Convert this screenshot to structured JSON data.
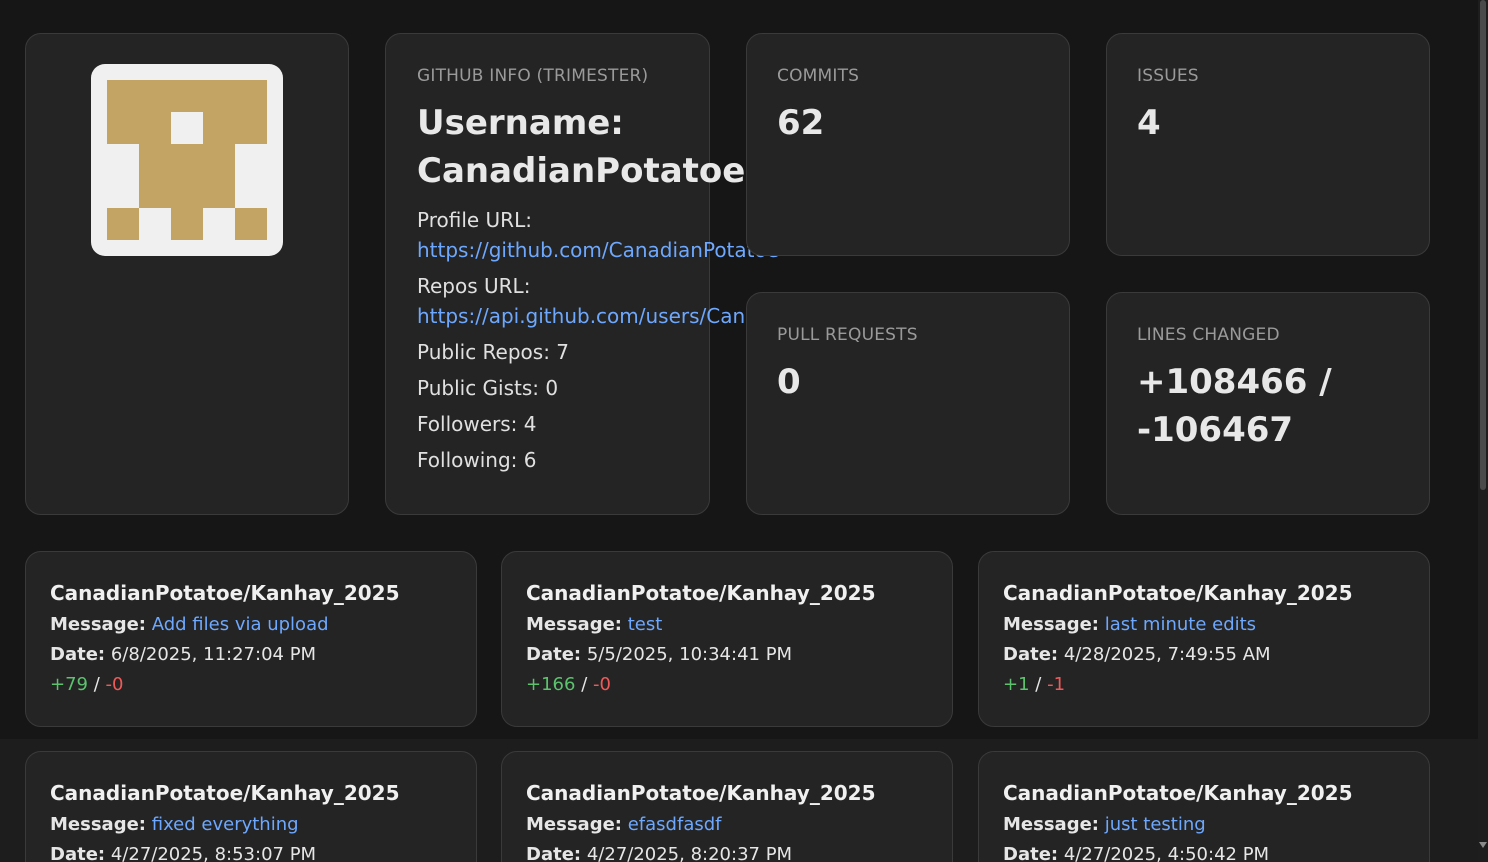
{
  "profile": {
    "avatar_colors": {
      "background": "#f0f0f0",
      "fill": "#c4a464"
    }
  },
  "info": {
    "heading": "GITHUB INFO (TRIMESTER)",
    "username_label": "Username:",
    "username": "CanadianPotatoe",
    "profile_url_label": "Profile URL:",
    "profile_url": "https://github.com/CanadianPotatoe",
    "repos_url_label": "Repos URL:",
    "repos_url": "https://api.github.com/users/CanadianPotatoe/repos",
    "public_repos": "Public Repos: 7",
    "public_gists": "Public Gists: 0",
    "followers": "Followers: 4",
    "following": "Following: 6"
  },
  "stats": {
    "commits": {
      "label": "COMMITS",
      "value": "62"
    },
    "issues": {
      "label": "ISSUES",
      "value": "4"
    },
    "pull_requests": {
      "label": "PULL REQUESTS",
      "value": "0"
    },
    "lines_changed": {
      "label": "LINES CHANGED",
      "value_line1": "+108466 /",
      "value_line2": "-106467"
    }
  },
  "commit_labels": {
    "message": "Message:",
    "date": "Date:",
    "separator": "/"
  },
  "commits": [
    {
      "repo": "CanadianPotatoe/Kanhay_2025",
      "message": "Add files via upload",
      "date": "6/8/2025, 11:27:04 PM",
      "additions": "+79",
      "deletions": "-0"
    },
    {
      "repo": "CanadianPotatoe/Kanhay_2025",
      "message": "test",
      "date": "5/5/2025, 10:34:41 PM",
      "additions": "+166",
      "deletions": "-0"
    },
    {
      "repo": "CanadianPotatoe/Kanhay_2025",
      "message": "last minute edits",
      "date": "4/28/2025, 7:49:55 AM",
      "additions": "+1",
      "deletions": "-1"
    },
    {
      "repo": "CanadianPotatoe/Kanhay_2025",
      "message": "fixed everything",
      "date": "4/27/2025, 8:53:07 PM"
    },
    {
      "repo": "CanadianPotatoe/Kanhay_2025",
      "message": "efasdfasdf",
      "date": "4/27/2025, 8:20:37 PM"
    },
    {
      "repo": "CanadianPotatoe/Kanhay_2025",
      "message": "just testing",
      "date": "4/27/2025, 4:50:42 PM"
    }
  ],
  "colors": {
    "link": "#6ea8fe",
    "additions": "#5cc26e",
    "deletions": "#ee5a5a",
    "card": "#242424",
    "page": "#161616"
  }
}
